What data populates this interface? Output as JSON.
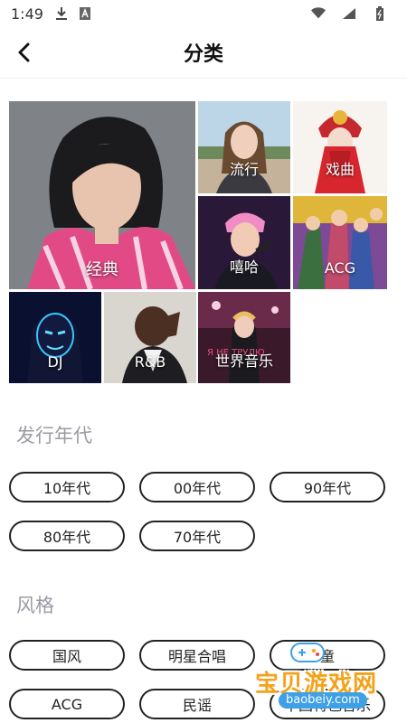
{
  "status_bar": {
    "time": "1:49",
    "icons": [
      "download-icon",
      "font-icon",
      "wifi-icon",
      "signal-icon",
      "battery-icon"
    ]
  },
  "header": {
    "title": "分类"
  },
  "categories": [
    {
      "label": "经典"
    },
    {
      "label": "流行"
    },
    {
      "label": "戏曲"
    },
    {
      "label": "嘻哈"
    },
    {
      "label": "ACG"
    },
    {
      "label": "DJ"
    },
    {
      "label": "R&B"
    },
    {
      "label": "世界音乐"
    }
  ],
  "era_section": {
    "title": "发行年代",
    "chips": [
      "10年代",
      "00年代",
      "90年代",
      "80年代",
      "70年代"
    ]
  },
  "style_section": {
    "title": "风格",
    "chips": [
      "国风",
      "明星合唱",
      "童",
      "ACG",
      "民谣",
      "中国特色音乐"
    ]
  },
  "watermark": {
    "brand": "宝贝游戏网",
    "url": "baobeiy.com"
  },
  "colors": {
    "accent": "#222222",
    "section_title": "#9a9aa4",
    "watermark_orange": "#f4a21a",
    "watermark_blue": "#3fa0e6"
  }
}
